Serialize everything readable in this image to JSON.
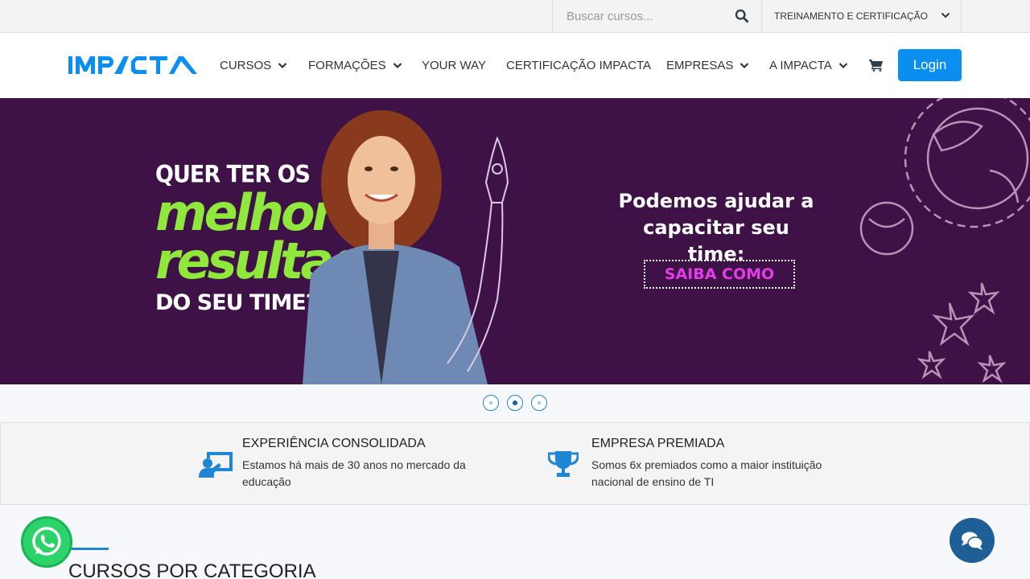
{
  "topbar": {
    "search_placeholder": "Buscar cursos...",
    "search_icon": "search-icon",
    "training_menu": "TREINAMENTO E CERTIFICAÇÃO"
  },
  "nav": {
    "logo_text": "IMPACTA",
    "items": [
      {
        "label": "CURSOS",
        "dropdown": true
      },
      {
        "label": "FORMAÇÕES",
        "dropdown": true
      },
      {
        "label": "YOUR WAY",
        "dropdown": false
      },
      {
        "label": "CERTIFICAÇÃO IMPACTA",
        "dropdown": false
      },
      {
        "label": "EMPRESAS",
        "dropdown": true
      },
      {
        "label": "A IMPACTA",
        "dropdown": true
      }
    ],
    "cart_icon": "cart-icon",
    "login_label": "Login"
  },
  "hero": {
    "line1": "QUER TER OS",
    "line2": "melhores",
    "line3": "resultados",
    "line4": "DO SEU TIME?",
    "right_title": "Podemos ajudar a capacitar seu time:",
    "cta": "SAIBA COMO",
    "slides": 3,
    "active_slide": 2
  },
  "features": [
    {
      "icon": "presentation-icon",
      "title": "EXPERIÊNCIA CONSOLIDADA",
      "text": "Estamos há mais de 30 anos no mercado da educação"
    },
    {
      "icon": "trophy-icon",
      "title": "EMPRESA PREMIADA",
      "text": "Somos 6x premiados como a maior instituição nacional de ensino de TI"
    }
  ],
  "categories": {
    "title": "CURSOS POR CATEGORIA"
  },
  "colors": {
    "accent": "#0a8ef0",
    "hero_bg": "#3f1247",
    "hero_green": "#8fe83b",
    "cta_pink": "#e33ce8",
    "whatsapp": "#2bd36a",
    "chat": "#1e5f96"
  }
}
